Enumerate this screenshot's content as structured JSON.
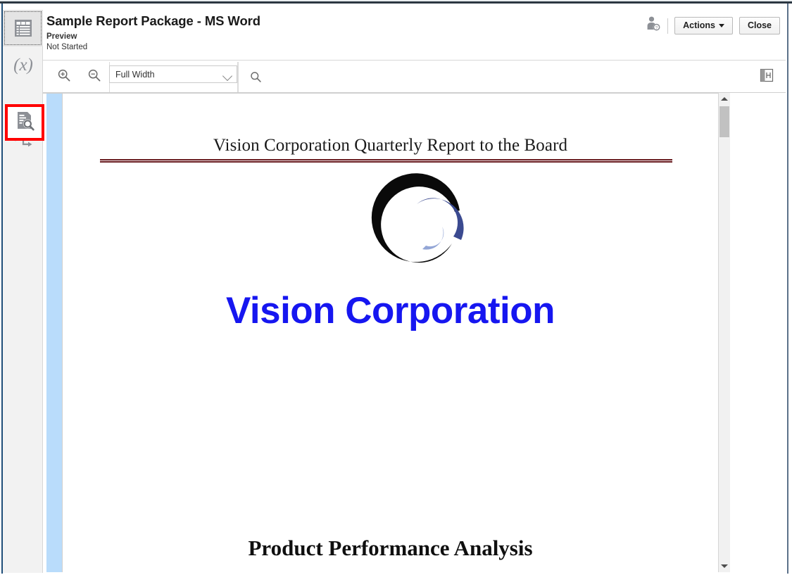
{
  "window": {
    "app_title": "Sample Report Package - MS Word"
  },
  "header": {
    "title": "Sample Report Package - MS Word",
    "phase_label": "Preview",
    "status_label": "Not Started",
    "user_icon": "user-status-icon",
    "actions_button": "Actions",
    "close_button": "Close"
  },
  "sidebar": {
    "items": [
      {
        "id": "report-center",
        "icon": "report-table-icon",
        "selected": true
      },
      {
        "id": "variables",
        "icon": "variable-x-icon",
        "selected": false
      },
      {
        "id": "preview-review",
        "icon": "document-magnifier-icon",
        "selected": false,
        "highlighted": true
      },
      {
        "id": "workflow",
        "icon": "workflow-branch-icon",
        "selected": false
      }
    ],
    "highlight_color": "#ff0000"
  },
  "toolbar": {
    "zoom_in_icon": "zoom-in-icon",
    "zoom_out_icon": "zoom-out-icon",
    "zoom_select_value": "Full Width",
    "zoom_select_options": [
      "Full Width"
    ],
    "search_icon": "search-icon",
    "search_value": "",
    "search_placeholder": "",
    "collapse_panel_icon": "collapse-panel-icon"
  },
  "document": {
    "report_title": "Vision Corporation Quarterly Report to the Board",
    "title_rule_color": "#6b1f23",
    "logo_icon": "vision-corporation-spiral-logo",
    "logo_colors": {
      "outer": "#0a0a0a",
      "middle": "#3b4a90",
      "inner": "#93a6d6"
    },
    "company_name": "Vision Corporation",
    "company_name_color": "#1616f0",
    "section_heading": "Product Performance Analysis"
  },
  "scrollbar": {
    "up_arrow": "scroll-up-arrow",
    "down_arrow": "scroll-down-arrow",
    "thumb": "scroll-thumb"
  }
}
